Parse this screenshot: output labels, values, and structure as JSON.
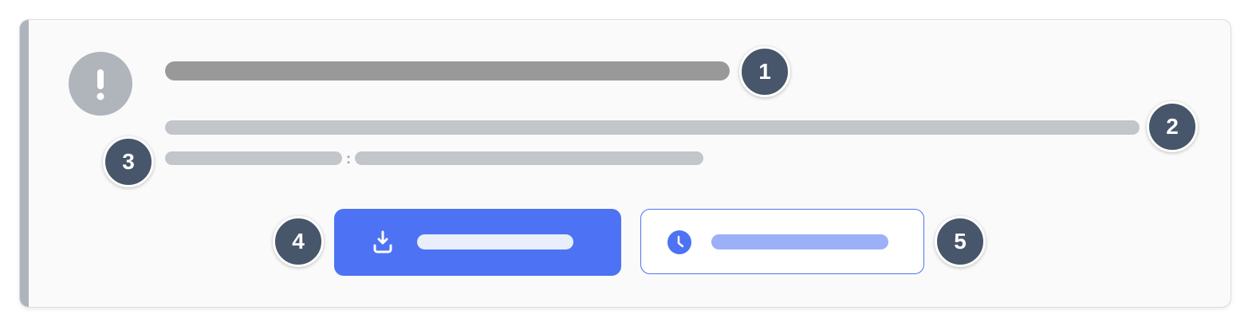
{
  "alert": {
    "icon": "exclamation-icon",
    "title": "",
    "description": "",
    "meta_label": "",
    "meta_separator": ":",
    "meta_value": ""
  },
  "actions": {
    "primary": {
      "icon": "download-icon",
      "label": ""
    },
    "secondary": {
      "icon": "clock-icon",
      "label": ""
    }
  },
  "markers": [
    "1",
    "2",
    "3",
    "4",
    "5"
  ],
  "colors": {
    "accent_stripe": "#aeb4bc",
    "primary": "#4d72f3",
    "marker": "#47566a",
    "title_placeholder": "#999999",
    "text_placeholder": "#c2c5c9"
  }
}
